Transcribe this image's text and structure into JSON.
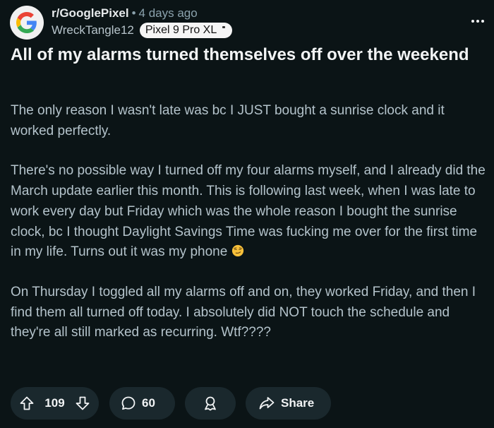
{
  "post": {
    "subreddit": "r/GooglePixel",
    "separator": "•",
    "time_ago": "4 days ago",
    "author": "WreckTangle12",
    "flair": "Pixel 9 Pro XL",
    "title": "All of my alarms turned themselves off over the weekend",
    "body": [
      "The only reason I wasn't late was bc I JUST bought a sunrise clock and it worked perfectly.",
      "There's no possible way I turned off my four alarms myself, and I already did the March update earlier this month. This is following last week, when I was late to work every day but Friday which was the whole reason I bought the sunrise clock, bc I thought Daylight Savings Time was fucking me over for the first time in my life. Turns out it was my phone",
      "On Thursday I toggled all my alarms off and on, they worked Friday, and then I find them all turned off today. I absolutely did NOT touch the schedule and they're all still marked as recurring. Wtf????"
    ],
    "emoji": "smirking-face-icon"
  },
  "actions": {
    "vote_count": "109",
    "comment_count": "60",
    "share_label": "Share"
  },
  "colors": {
    "background": "#0b1416",
    "pill": "#1a282d",
    "body_text": "#b4c3cb",
    "flair_bg": "#f5f5f5"
  }
}
